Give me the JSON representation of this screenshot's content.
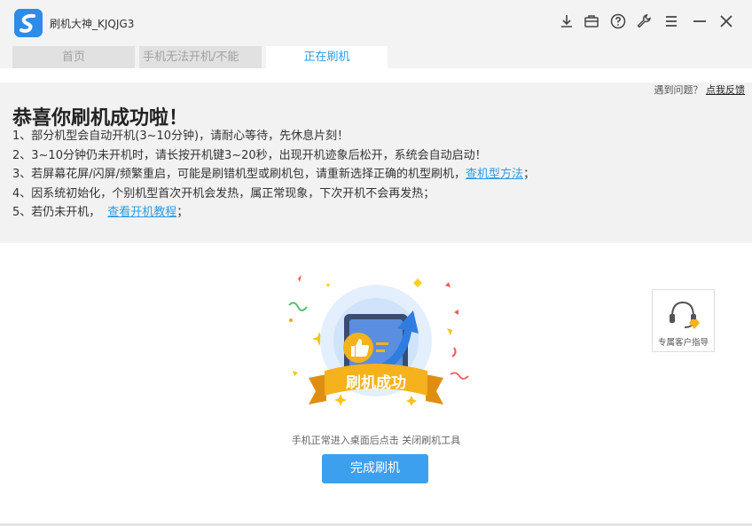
{
  "window": {
    "title": "刷机大神_KJQJG3",
    "logo_icon": "app-logo-icon",
    "toolbar_icons": [
      "download-icon",
      "briefcase-icon",
      "help-icon",
      "wrench-icon",
      "menu-icon",
      "minimize-icon",
      "close-icon"
    ]
  },
  "tabs": [
    {
      "label": "首页",
      "active": false
    },
    {
      "label": "手机无法开机/不能",
      "active": false
    },
    {
      "label": "正在刷机",
      "active": true
    }
  ],
  "feedback": {
    "prompt": "遇到问题？",
    "link": "点我反馈"
  },
  "main": {
    "headline": "恭喜你刷机成功啦！",
    "tips": [
      {
        "text": "1、部分机型会自动开机(3~10分钟)，请耐心等待，先休息片刻！"
      },
      {
        "text": "2、3~10分钟仍未开机时，请长按开机键3~20秒，出现开机迹象后松开，系统会自动启动！"
      },
      {
        "text": "3、若屏幕花屏/闪屏/频繁重启，可能是刷错机型或刷机包，请重新选择正确的机型刷机，",
        "link": "查机型方法",
        "after": "；"
      },
      {
        "text": "4、因系统初始化，个别机型首次开机会发热，属正常现象，下次开机不会再发热；"
      },
      {
        "text": "5、若仍未开机，",
        "link": "查看开机教程",
        "after": "；"
      }
    ]
  },
  "success": {
    "banner_text": "刷机成功",
    "caption": "手机正常进入桌面后点击 关闭刷机工具",
    "button": "完成刷机"
  },
  "support": {
    "label": "专属客户指导",
    "icon": "headset-icon"
  },
  "colors": {
    "accent": "#2f9be6",
    "button": "#3da0ef",
    "banner": "#f5b21c"
  }
}
